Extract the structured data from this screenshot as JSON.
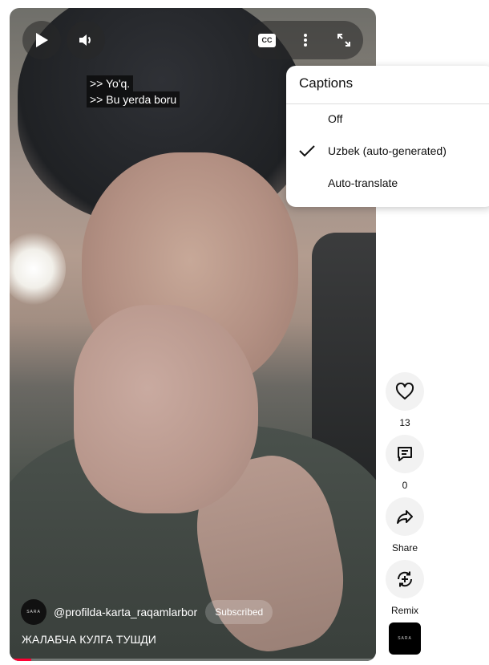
{
  "player": {
    "captions_overlay": [
      ">> Yo'q.",
      ">> Bu yerda boru"
    ],
    "cc_label": "CC",
    "channel_handle": "@profilda-karta_raqamlarbor",
    "channel_avatar_text": "SARA",
    "subscribe_label": "Subscribed",
    "video_title": "ЖАЛАБЧА КУЛГА ТУШДИ",
    "progress_fraction": 0.06
  },
  "captions_menu": {
    "title": "Captions",
    "items": [
      {
        "label": "Off",
        "selected": false
      },
      {
        "label": "Uzbek (auto-generated)",
        "selected": true
      },
      {
        "label": "Auto-translate",
        "selected": false
      }
    ]
  },
  "actions": {
    "like_count": "13",
    "comment_count": "0",
    "share_label": "Share",
    "remix_label": "Remix",
    "sound_thumb_text": "SARA"
  },
  "icons": {
    "play": "play-icon",
    "volume": "volume-icon",
    "cc": "closed-captions-icon",
    "more": "more-vert-icon",
    "fullscreen": "fullscreen-icon",
    "check": "check-icon",
    "like": "heart-icon",
    "comment": "comment-icon",
    "share": "share-icon",
    "remix": "remix-icon"
  },
  "colors": {
    "progress": "#ff0033",
    "menu_bg": "#ffffff",
    "action_bg": "#f2f2f2"
  }
}
